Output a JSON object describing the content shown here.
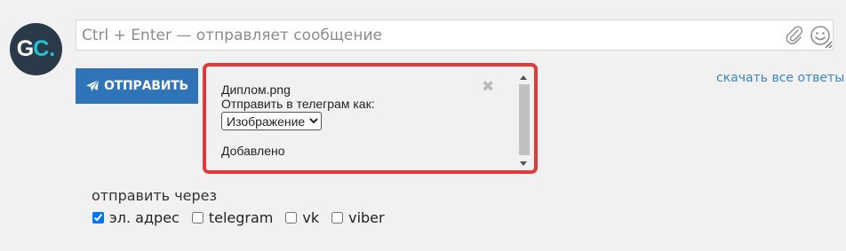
{
  "avatar": {
    "letters": "GC",
    "accent": "#22c3d8"
  },
  "composer": {
    "placeholder": "Ctrl + Enter — отправляет сообщение",
    "icons": [
      "paperclip-icon",
      "smile-icon",
      "resize-handle-icon"
    ]
  },
  "send_button": {
    "label": "ОТПРАВИТЬ",
    "icon": "paper-plane-icon",
    "color": "#2f73b8"
  },
  "attachment": {
    "filename": "Диплом.png",
    "send_as_label": "Отправить в телеграм как:",
    "type_options": [
      "Изображение"
    ],
    "selected_type": "Изображение",
    "status": "Добавлено",
    "close_symbol": "✖",
    "highlight_color": "#df3b3b"
  },
  "download_all_link": "скачать все ответы",
  "delivery": {
    "label": "отправить через",
    "channels": [
      {
        "label": "эл. адрес",
        "checked": true
      },
      {
        "label": "telegram",
        "checked": false
      },
      {
        "label": "vk",
        "checked": false
      },
      {
        "label": "viber",
        "checked": false
      }
    ]
  }
}
